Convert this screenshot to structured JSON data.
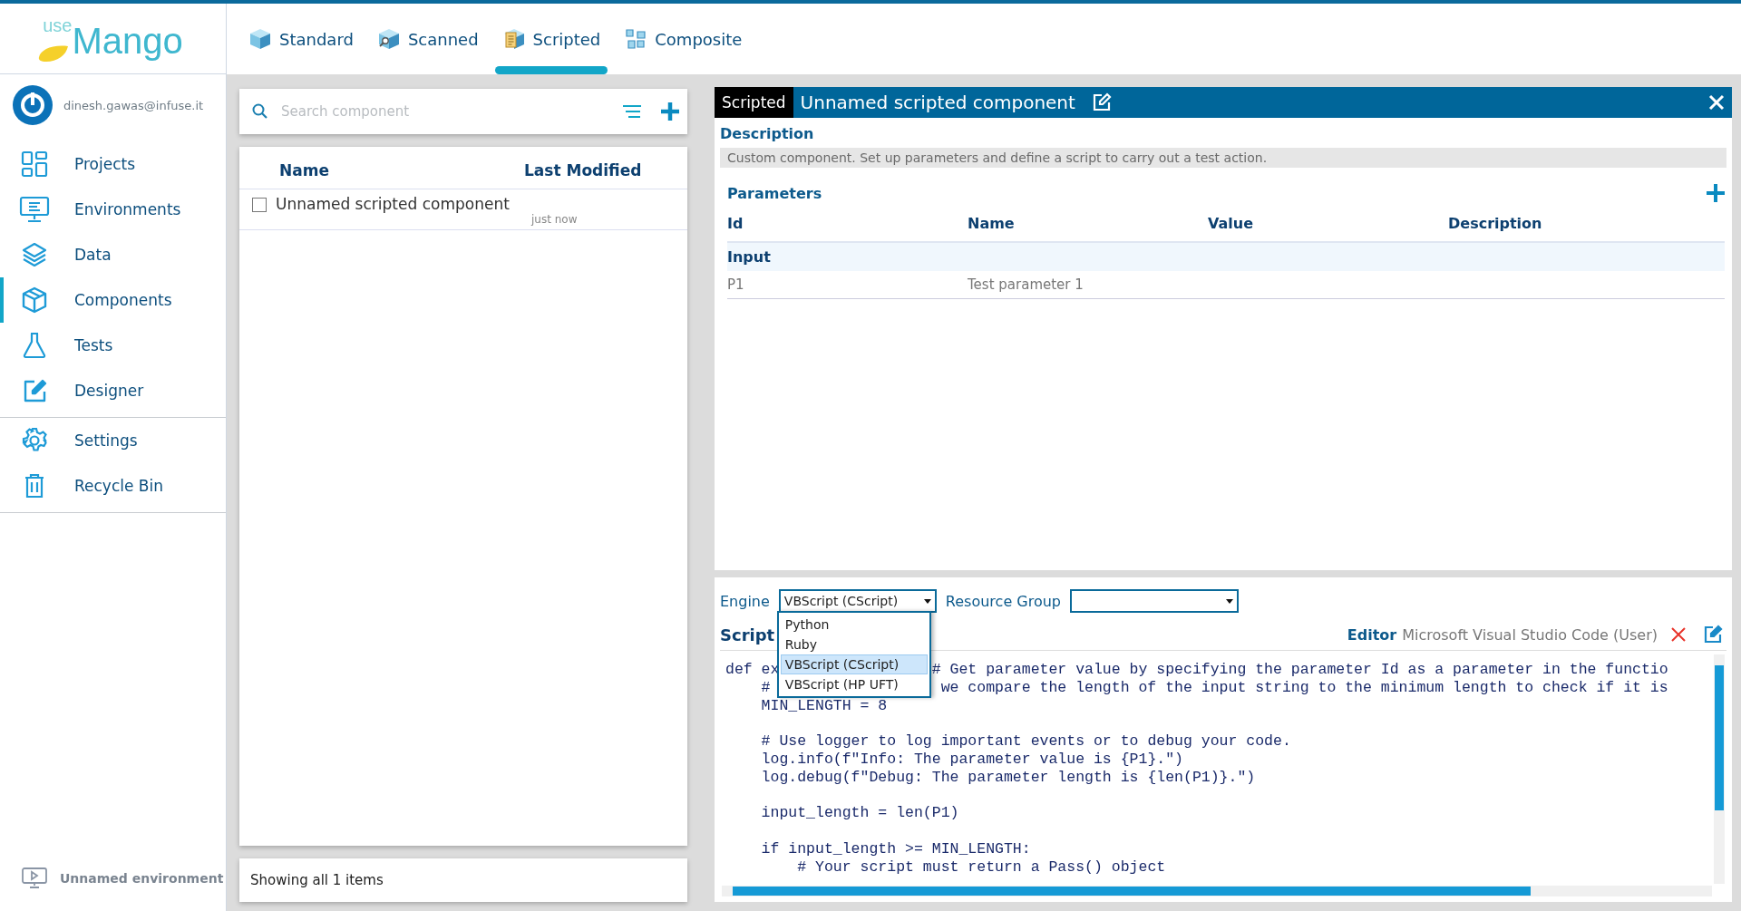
{
  "logo": {
    "prefix": "use",
    "name": "Mango"
  },
  "tabs": [
    {
      "label": "Standard",
      "selected": false
    },
    {
      "label": "Scanned",
      "selected": false
    },
    {
      "label": "Scripted",
      "selected": true
    },
    {
      "label": "Composite",
      "selected": false
    }
  ],
  "user": {
    "email": "dinesh.gawas@infuse.it"
  },
  "nav_groups": [
    [
      {
        "label": "Projects",
        "selected": false
      },
      {
        "label": "Environments",
        "selected": false
      },
      {
        "label": "Data",
        "selected": false
      },
      {
        "label": "Components",
        "selected": true
      },
      {
        "label": "Tests",
        "selected": false
      },
      {
        "label": "Designer",
        "selected": false
      }
    ],
    [
      {
        "label": "Settings",
        "selected": false
      },
      {
        "label": "Recycle Bin",
        "selected": false
      }
    ]
  ],
  "environment": "Unnamed environment",
  "component_list": {
    "search_placeholder": "Search component",
    "columns": [
      "Name",
      "Last Modified"
    ],
    "rows": [
      {
        "name": "Unnamed scripted component",
        "modified": "just now",
        "checked": false
      }
    ],
    "footer": "Showing all 1 items"
  },
  "editor_panel": {
    "type_tag": "Scripted",
    "title": "Unnamed scripted component",
    "description_label": "Description",
    "description": "Custom component. Set up parameters and define a script to carry out a test action.",
    "parameters_label": "Parameters",
    "param_columns": [
      "Id",
      "Name",
      "Value",
      "Description"
    ],
    "param_groups": [
      {
        "name": "Input",
        "rows": [
          {
            "id": "P1",
            "name": "Test parameter 1"
          }
        ]
      }
    ],
    "engine_label": "Engine",
    "engine_value": "VBScript (CScript)",
    "engine_options": [
      {
        "label": "Python",
        "selected": false
      },
      {
        "label": "Ruby",
        "selected": false
      },
      {
        "label": "VBScript (CScript)",
        "selected": true
      },
      {
        "label": "VBScript (HP UFT)",
        "selected": false
      }
    ],
    "resource_group_label": "Resource Group",
    "script_label": "Script",
    "editor_label": "Editor",
    "editor_value": "Microsoft Visual Studio Code (User)",
    "code_lines": [
      {
        "kind": "code",
        "text": "def ex",
        "after": "# Get parameter value by specifying the parameter Id as a parameter in the functio"
      },
      {
        "kind": "code",
        "text": "    #",
        "after": " we compare the length of the input string to the minimum length to check if it is"
      },
      {
        "kind": "code",
        "text": "    MIN_LENGTH = 8"
      },
      {
        "kind": "blank"
      },
      {
        "kind": "code",
        "text": "    # Use logger to log important events or to debug your code."
      },
      {
        "kind": "code",
        "text": "    log.info(f\"Info: The parameter value is {P1}.\")"
      },
      {
        "kind": "code",
        "text": "    log.debug(f\"Debug: The parameter length is {len(P1)}.\")"
      },
      {
        "kind": "blank"
      },
      {
        "kind": "code",
        "text": "    input_length = len(P1)"
      },
      {
        "kind": "blank"
      },
      {
        "kind": "code",
        "text": "    if input_length >= MIN_LENGTH:"
      },
      {
        "kind": "code",
        "text": "        # Your script must return a Pass() object"
      }
    ]
  }
}
